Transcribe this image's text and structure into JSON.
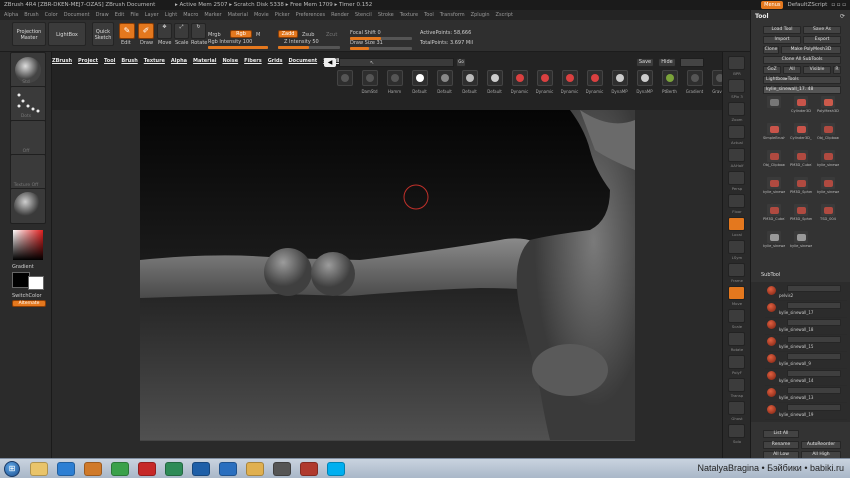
{
  "window": {
    "title": "ZBrush 4R4 [ZBR-DKEN-MEJ7-OZAS]   ZBrush Document",
    "stats": "▸ Active Mem 2507 ▸ Scratch Disk 5338 ▸ Free Mem 1709 ▸ Timer 0.152",
    "menus_btn": "Menus",
    "script_label": "DefaultZScript"
  },
  "menubar": [
    "Alpha",
    "Brush",
    "Color",
    "Document",
    "Draw",
    "Edit",
    "File",
    "Layer",
    "Light",
    "Macro",
    "Marker",
    "Material",
    "Movie",
    "Picker",
    "Preferences",
    "Render",
    "Stencil",
    "Stroke",
    "Texture",
    "Tool",
    "Transform",
    "Zplugin",
    "Zscript"
  ],
  "toolbar": {
    "projection_master": "Projection Master",
    "lightbox": "LightBox",
    "quick_sketch": "Quick Sketch",
    "edit": "Edit",
    "draw": "Draw",
    "move": "Move",
    "scale": "Scale",
    "rotate": "Rotate",
    "mrgb": "Mrgb",
    "rgb": "Rgb",
    "m": "M",
    "zadd": "Zadd",
    "zsub": "Zsub",
    "zcut": "Zcut",
    "rgb_intensity": "Rgb Intensity 100",
    "z_intensity": "Z Intensity 50",
    "focal_shift": "Focal Shift 0",
    "draw_size": "Draw Size 31",
    "active_points": "ActivePoints: 58,666",
    "total_points": "TotalPoints: 3.697 Mil",
    "rgb_intensity_level": 1.0,
    "z_intensity_level": 0.5,
    "focal_shift_level": 0.5,
    "draw_size_level": 0.3
  },
  "docmenu": [
    "ZBrush",
    "Project",
    "Tool",
    "Brush",
    "Texture",
    "Alpha",
    "Material",
    "Noise",
    "Fibers",
    "Grids",
    "Document",
    "Spotlight"
  ],
  "doc_controls": {
    "save": "Save",
    "hide": "Hide"
  },
  "brushes": [
    {
      "label": "",
      "color": "#555555"
    },
    {
      "label": "DamStd",
      "color": "#555555"
    },
    {
      "label": "Hamm",
      "color": "#555555"
    },
    {
      "label": "Default",
      "color": "#ffffff"
    },
    {
      "label": "Default",
      "color": "#888888"
    },
    {
      "label": "Default",
      "color": "#bbbbbb"
    },
    {
      "label": "Default",
      "color": "#cccccc"
    },
    {
      "label": "Dynamic",
      "color": "#d94040"
    },
    {
      "label": "Dynamic",
      "color": "#d94040"
    },
    {
      "label": "Dynamic",
      "color": "#d94040"
    },
    {
      "label": "Dynamic",
      "color": "#d94040"
    },
    {
      "label": "DynaMP",
      "color": "#cccccc"
    },
    {
      "label": "DynaMP",
      "color": "#cccccc"
    },
    {
      "label": "PtBerth",
      "color": "#7ba33a"
    },
    {
      "label": "Gradient",
      "color": "#555555"
    },
    {
      "label": "Gravity",
      "color": "#555555"
    }
  ],
  "leftshelf": {
    "gradient": "Gradient",
    "switch_color": "SwitchColor",
    "alternate": "Alternate",
    "captions": [
      "Std",
      "",
      "Dots",
      "Off",
      "Texture Off",
      "",
      "",
      ""
    ]
  },
  "rightshelf": [
    "BPR",
    "SPix 3",
    "Zoom",
    "Actual",
    "AAHalf",
    "Persp",
    "Floor",
    "Local",
    "LSym",
    "Frame",
    "Move",
    "Scale",
    "Rotate",
    "PolyF",
    "Transp",
    "Ghost",
    "Solo"
  ],
  "toolpanel": {
    "title": "Tool",
    "load_tool": "Load Tool",
    "save_as": "Save As",
    "import": "Import",
    "export": "Export",
    "clone": "Clone",
    "make_polymesh": "Make PolyMesh3D",
    "clone_all": "Clone All SubTools",
    "goz": "GoZ",
    "all": "All",
    "visible": "Visible",
    "r": "R",
    "lightbox_tools": "Lightbox▸Tools",
    "current_tool": "kylie_sinewall_17. 48",
    "tools": [
      {
        "label": "",
        "color": "#777777"
      },
      {
        "label": "Cylinder3D",
        "color": "#c9544a"
      },
      {
        "label": "PolyMesh3D",
        "color": "#cc5a4b"
      },
      {
        "label": "SimpleBrush",
        "color": "#c9544a"
      },
      {
        "label": "Cylinder3D_1",
        "color": "#c9544a"
      },
      {
        "label": "Obj_Clipboard",
        "color": "#b04a40"
      },
      {
        "label": "Obj_Clipboard",
        "color": "#b04a40"
      },
      {
        "label": "PM3D_Cube3D",
        "color": "#b04a40"
      },
      {
        "label": "kylie_sinewall",
        "color": "#b04a40"
      },
      {
        "label": "kylie_sinewall",
        "color": "#b04a40"
      },
      {
        "label": "PM3D_Sphere3D",
        "color": "#b04a40"
      },
      {
        "label": "kylie_sinewall",
        "color": "#b04a40"
      },
      {
        "label": "PM3D_Cube3D",
        "color": "#b04a40"
      },
      {
        "label": "PM3D_Sphere3D",
        "color": "#b04a40"
      },
      {
        "label": "TSD_004",
        "color": "#b04a40"
      },
      {
        "label": "kylie_sinewall",
        "color": "#999999"
      },
      {
        "label": "kylie_sinewall",
        "color": "#999999"
      }
    ],
    "subtool_header": "SubTool",
    "subtools": [
      "pelvis2",
      "kylie_sinewall_17",
      "kylie_sinewall_18",
      "kylie_sinewall_15",
      "kylie_sinewall_9",
      "kylie_sinewall_14",
      "kylie_sinewall_13",
      "kylie_sinewall_19"
    ],
    "list_all": "List All",
    "rename": "Rename",
    "auto_reorder": "AutoReorder",
    "all_low": "All Low",
    "all_high": "All High"
  },
  "taskbar": {
    "watermark": "NatalyaBragina • Бэйбики • babiki.ru",
    "apps": [
      {
        "name": "folder-icon",
        "color": "#e9c46a"
      },
      {
        "name": "ie-icon",
        "color": "#2d7fd3"
      },
      {
        "name": "media-icon",
        "color": "#d07a2a"
      },
      {
        "name": "chrome-icon",
        "color": "#3aa14b"
      },
      {
        "name": "pdf-icon",
        "color": "#c62828"
      },
      {
        "name": "calc-icon",
        "color": "#2e8b57"
      },
      {
        "name": "photoshop-icon",
        "color": "#1e5fa8"
      },
      {
        "name": "paint-icon",
        "color": "#2a6fbf"
      },
      {
        "name": "explorer-icon",
        "color": "#e0b050"
      },
      {
        "name": "zbrush-icon",
        "color": "#555555"
      },
      {
        "name": "gallery-icon",
        "color": "#b03a2e"
      },
      {
        "name": "skype-icon",
        "color": "#00aff0"
      }
    ]
  }
}
